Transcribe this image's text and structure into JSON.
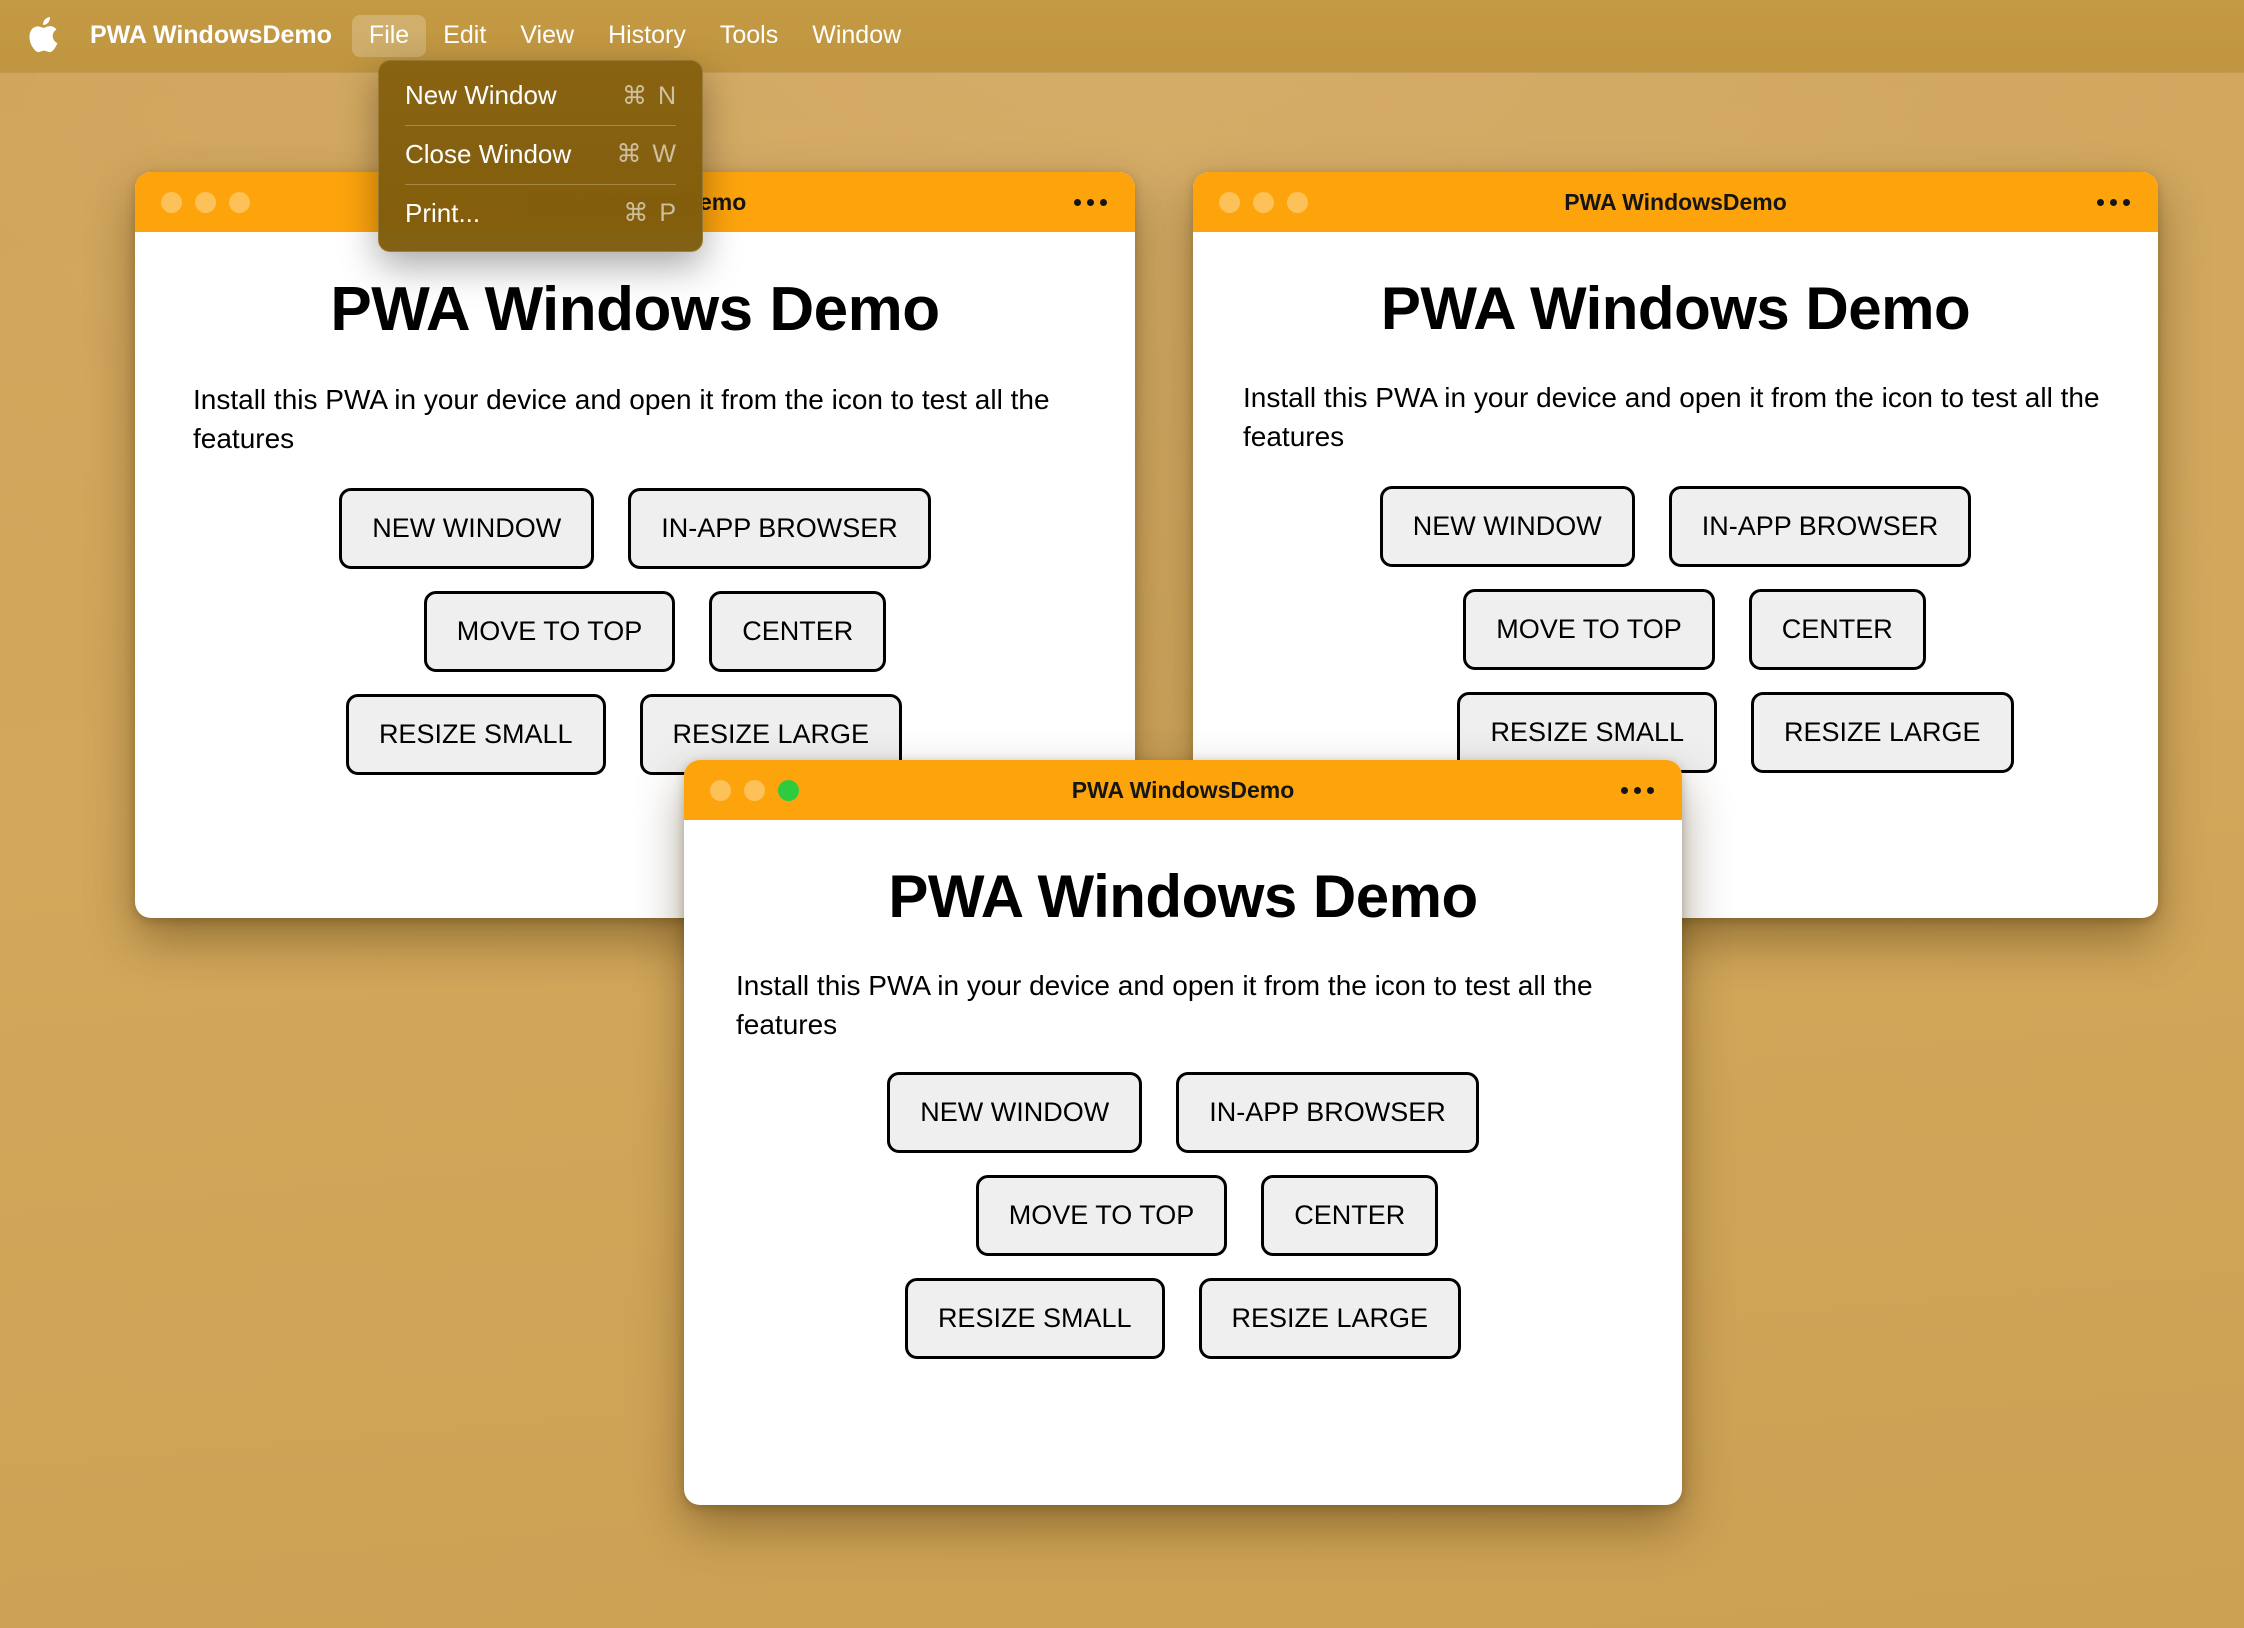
{
  "menubar": {
    "apple_icon": "apple-logo-icon",
    "app_name": "PWA WindowsDemo",
    "items": [
      {
        "label": "File",
        "active": true
      },
      {
        "label": "Edit",
        "active": false
      },
      {
        "label": "View",
        "active": false
      },
      {
        "label": "History",
        "active": false
      },
      {
        "label": "Tools",
        "active": false
      },
      {
        "label": "Window",
        "active": false
      }
    ]
  },
  "file_menu": {
    "open": true,
    "items": [
      {
        "label": "New Window",
        "shortcut": "⌘ N"
      },
      {
        "label": "Close Window",
        "shortcut": "⌘ W"
      },
      {
        "label": "Print...",
        "shortcut": "⌘ P"
      }
    ]
  },
  "colors": {
    "desktop": "#d2a558",
    "menubar": "#c0953f",
    "menu_dropdown": "#86610e",
    "titlebar": "#fda40d",
    "button_face": "#efefef",
    "button_border": "#000000",
    "light_green": "#2ecb3e",
    "light_inactive": "rgba(255,255,255,0.32)"
  },
  "windows": [
    {
      "id": "win1",
      "title": "PWA WindowsDemo",
      "active": false,
      "overflow_icon": "ellipsis-icon",
      "lights": [
        "close-inactive",
        "minimize-inactive",
        "maximize-inactive"
      ],
      "heading": "PWA Windows Demo",
      "paragraph": "Install this PWA in your device and open it from the icon to test all the features",
      "buttons": [
        [
          "NEW WINDOW",
          "IN-APP BROWSER"
        ],
        [
          "MOVE TO TOP",
          "CENTER"
        ],
        [
          "RESIZE SMALL",
          "RESIZE LARGE"
        ]
      ]
    },
    {
      "id": "win2",
      "title": "PWA WindowsDemo",
      "active": false,
      "overflow_icon": "ellipsis-icon",
      "lights": [
        "close-inactive",
        "minimize-inactive",
        "maximize-inactive"
      ],
      "heading": "PWA Windows Demo",
      "paragraph": "Install this PWA in your device and open it from the icon to test all the features",
      "buttons": [
        [
          "NEW WINDOW",
          "IN-APP BROWSER"
        ],
        [
          "MOVE TO TOP",
          "CENTER"
        ],
        [
          "RESIZE SMALL",
          "RESIZE LARGE"
        ]
      ]
    },
    {
      "id": "win3",
      "title": "PWA WindowsDemo",
      "active": true,
      "overflow_icon": "ellipsis-icon",
      "lights": [
        "close-inactive",
        "minimize-inactive",
        "maximize-active"
      ],
      "heading": "PWA Windows Demo",
      "paragraph": "Install this PWA in your device and open it from the icon to test all the features",
      "buttons": [
        [
          "NEW WINDOW",
          "IN-APP BROWSER"
        ],
        [
          "MOVE TO TOP",
          "CENTER"
        ],
        [
          "RESIZE SMALL",
          "RESIZE LARGE"
        ]
      ]
    }
  ]
}
